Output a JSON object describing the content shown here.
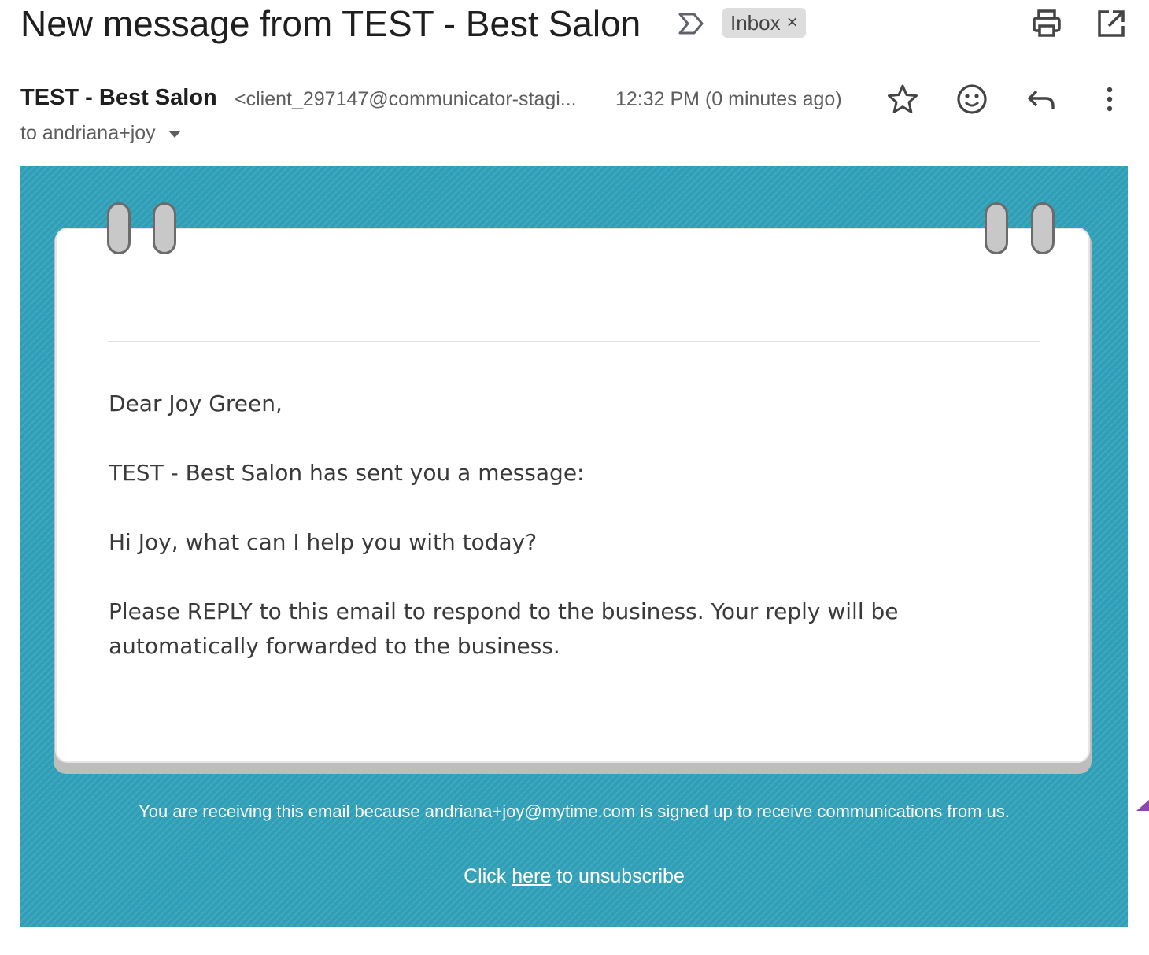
{
  "header": {
    "subject": "New message from TEST - Best Salon",
    "label_chip": "Inbox",
    "label_chip_remove": "×"
  },
  "sender": {
    "name": "TEST - Best Salon",
    "email": "<client_297147@communicator-stagi...",
    "time": "12:32 PM (0 minutes ago)",
    "to": "to andriana+joy"
  },
  "message": {
    "greeting": "Dear Joy Green,",
    "intro": "TEST - Best Salon has sent you a message:",
    "body": "Hi Joy, what can I help you with today?",
    "reply_line1": "Please REPLY to this email to respond to the business. Your reply will be",
    "reply_line2": "automatically forwarded to the business."
  },
  "footer": {
    "notice": "You are receiving this email because andriana+joy@mytime.com is signed up to receive communications from us.",
    "unsubscribe_prefix": "Click",
    "unsubscribe_link": "here",
    "unsubscribe_suffix": "to unsubscribe"
  },
  "icons": {
    "label": "label-arrow-icon",
    "print": "print-icon",
    "open_new": "open-in-new-window-icon",
    "star": "star-icon",
    "emoji": "emoji-reaction-icon",
    "reply": "reply-icon",
    "more": "more-options-icon"
  },
  "colors": {
    "email_background": "#2f9fb7",
    "notepad": "#ffffff",
    "text": "#3a3a3a"
  }
}
